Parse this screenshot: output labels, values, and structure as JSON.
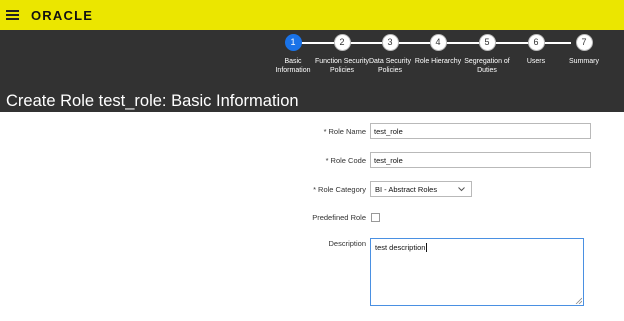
{
  "header": {
    "logo": "ORACLE"
  },
  "train": {
    "steps": [
      {
        "number": "1",
        "label": "Basic Information",
        "active": true
      },
      {
        "number": "2",
        "label": "Function Security Policies",
        "active": false
      },
      {
        "number": "3",
        "label": "Data Security Policies",
        "active": false
      },
      {
        "number": "4",
        "label": "Role Hierarchy",
        "active": false
      },
      {
        "number": "5",
        "label": "Segregation of Duties",
        "active": false
      },
      {
        "number": "6",
        "label": "Users",
        "active": false
      },
      {
        "number": "7",
        "label": "Summary",
        "active": false
      }
    ]
  },
  "page": {
    "title": "Create Role test_role: Basic Information"
  },
  "form": {
    "required_marker": "*",
    "role_name_label": "Role Name",
    "role_name_value": "test_role",
    "role_code_label": "Role Code",
    "role_code_value": "test_role",
    "role_category_label": "Role Category",
    "role_category_value": "BI - Abstract Roles",
    "predefined_role_label": "Predefined Role",
    "predefined_role_checked": false,
    "description_label": "Description",
    "description_value": "test description"
  },
  "colors": {
    "topbar": "#ebe600",
    "dark_band": "#323232",
    "active_step": "#1a73e8"
  },
  "icons": {
    "menu": "hamburger-icon",
    "dropdown": "chevron-down-icon"
  }
}
